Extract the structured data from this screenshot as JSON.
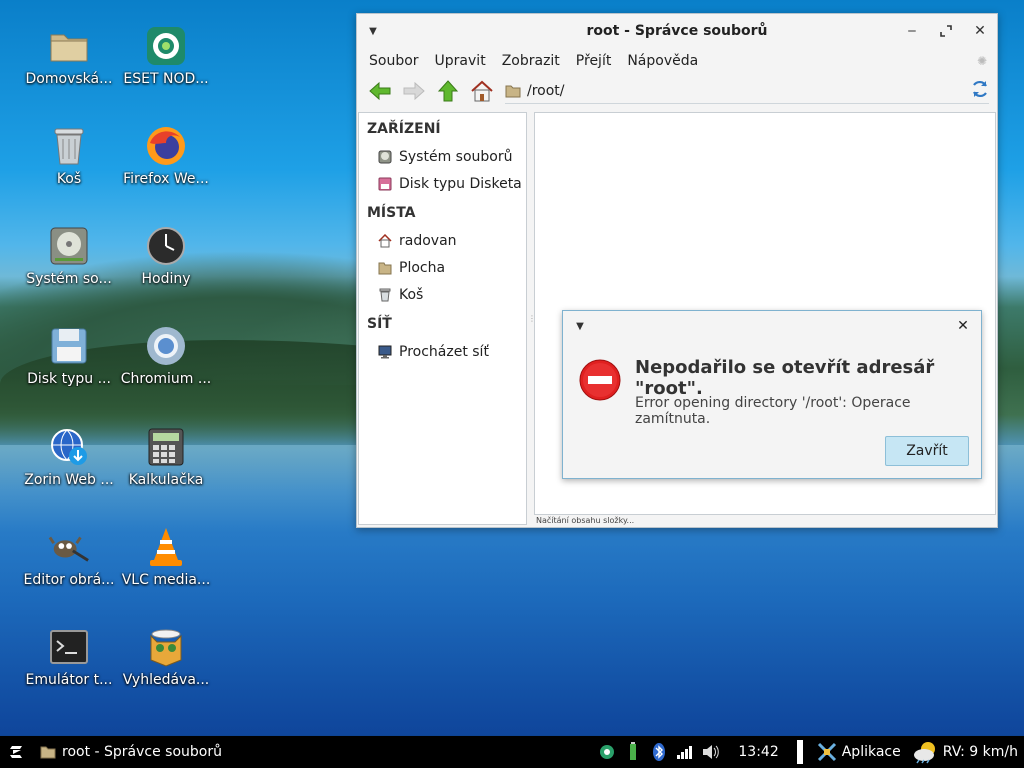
{
  "desktop": {
    "icons": [
      {
        "label": "Domovská...",
        "icon": "folder-icon"
      },
      {
        "label": "ESET NOD...",
        "icon": "eset-icon"
      },
      {
        "label": "Koš",
        "icon": "trash-icon"
      },
      {
        "label": "Firefox We...",
        "icon": "firefox-icon"
      },
      {
        "label": "Systém so...",
        "icon": "harddisk-icon"
      },
      {
        "label": "Hodiny",
        "icon": "clock-icon"
      },
      {
        "label": "Disk typu ...",
        "icon": "floppy-icon"
      },
      {
        "label": "Chromium ...",
        "icon": "chromium-icon"
      },
      {
        "label": "Zorin Web ...",
        "icon": "web-download-icon"
      },
      {
        "label": "Kalkulačka",
        "icon": "calculator-icon"
      },
      {
        "label": "Editor obrá...",
        "icon": "gimp-icon"
      },
      {
        "label": "VLC media...",
        "icon": "vlc-icon"
      },
      {
        "label": "Emulátor t...",
        "icon": "terminal-icon"
      },
      {
        "label": "Vyhledáva...",
        "icon": "search-cat-icon"
      }
    ]
  },
  "file_manager": {
    "title": "root - Správce souborů",
    "menu": [
      "Soubor",
      "Upravit",
      "Zobrazit",
      "Přejít",
      "Nápověda"
    ],
    "path": "/root/",
    "sidebar": {
      "devices_header": "ZAŘÍZENÍ",
      "devices": [
        "Systém souborů",
        "Disk typu Disketa"
      ],
      "places_header": "MÍSTA",
      "places": [
        "radovan",
        "Plocha",
        "Koš"
      ],
      "network_header": "SÍŤ",
      "network": [
        "Procházet síť"
      ]
    },
    "status": "Načítání obsahu složky..."
  },
  "dialog": {
    "title": "Nepodařilo se otevřít adresář \"root\".",
    "message": "Error opening directory '/root': Operace zamítnuta.",
    "button": "Zavřít"
  },
  "taskbar": {
    "task": "root - Správce souborů",
    "clock": "13:42",
    "apps": "Aplikace",
    "weather": "RV: 9 km/h"
  },
  "colors": {
    "dialog_button": "#c6e6f4",
    "error_red": "#e02020",
    "taskbar": "#000000"
  }
}
